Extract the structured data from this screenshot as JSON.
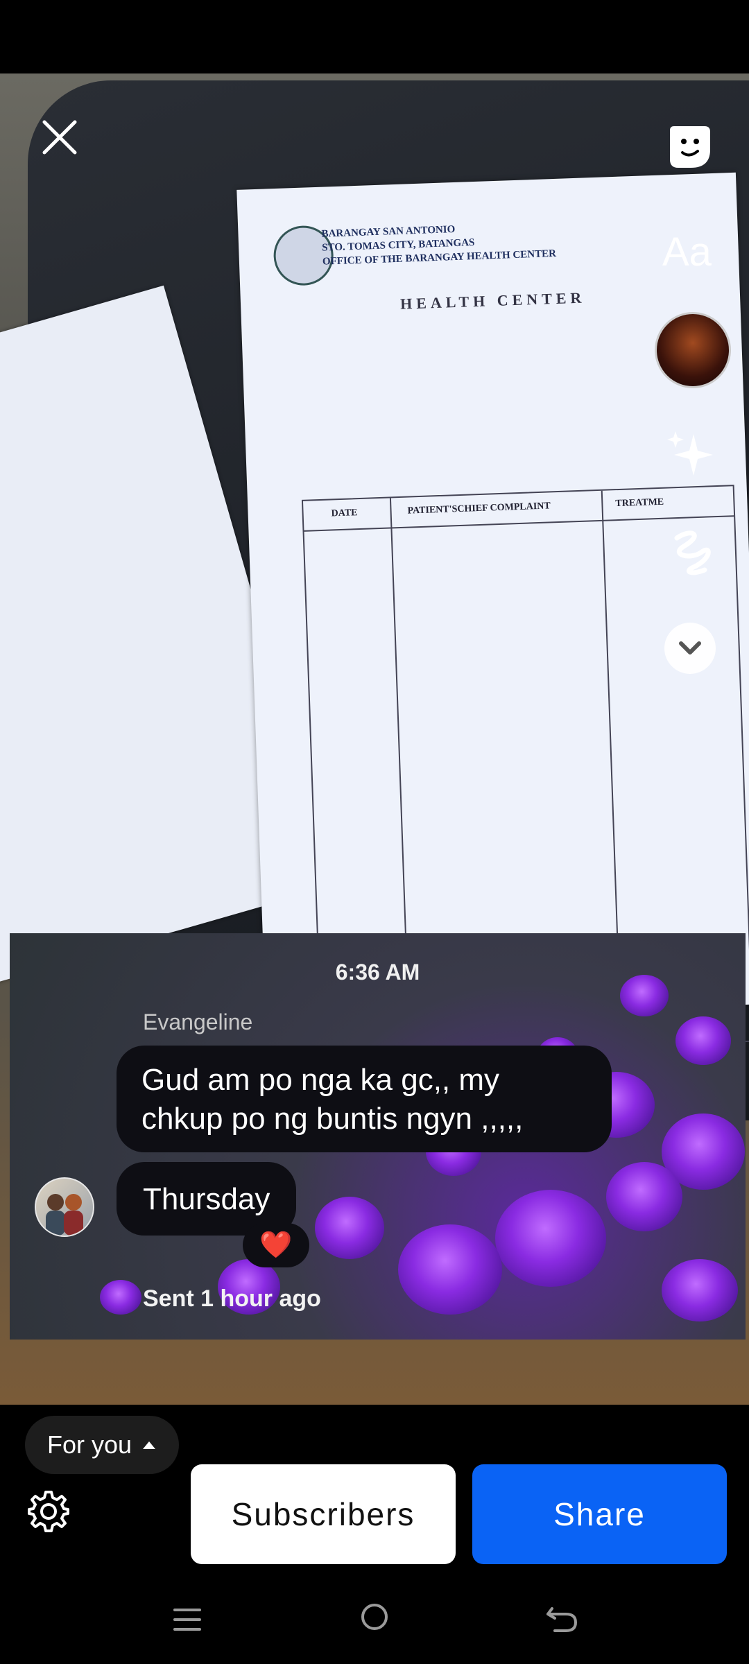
{
  "photo_document": {
    "header_lines": [
      "BARANGAY SAN ANTONIO",
      "STO. TOMAS CITY, BATANGAS",
      "OFFICE OF THE BARANGAY HEALTH CENTER"
    ],
    "heading": "HEALTH CENTER",
    "columns": [
      "DATE",
      "PATIENT'SCHIEF COMPLAINT",
      "TREATME"
    ]
  },
  "top_controls": {
    "text_tool_label": "Aa"
  },
  "message": {
    "time": "6:36 AM",
    "sender": "Evangeline",
    "bubbles": [
      "Gud am po nga ka gc,, my chkup po ng buntis ngyn ,,,,,",
      "Thursday"
    ],
    "reaction": "❤️",
    "status": "Sent 1 hour ago"
  },
  "bottom_bar": {
    "audience_label": "For you",
    "subscribers_label": "Subscribers",
    "share_label": "Share"
  },
  "colors": {
    "share_button": "#0a63f5",
    "subscribers_button": "#ffffff",
    "pill": "#1d1d1d",
    "background": "#000000"
  },
  "icons": [
    "close-icon",
    "sticker-icon",
    "music-icon",
    "effects-sparkle-icon",
    "draw-icon",
    "chevron-down-icon",
    "settings-gear-icon",
    "caret-up-icon",
    "nav-menu-icon",
    "nav-home-icon",
    "nav-back-icon",
    "heart-icon"
  ]
}
